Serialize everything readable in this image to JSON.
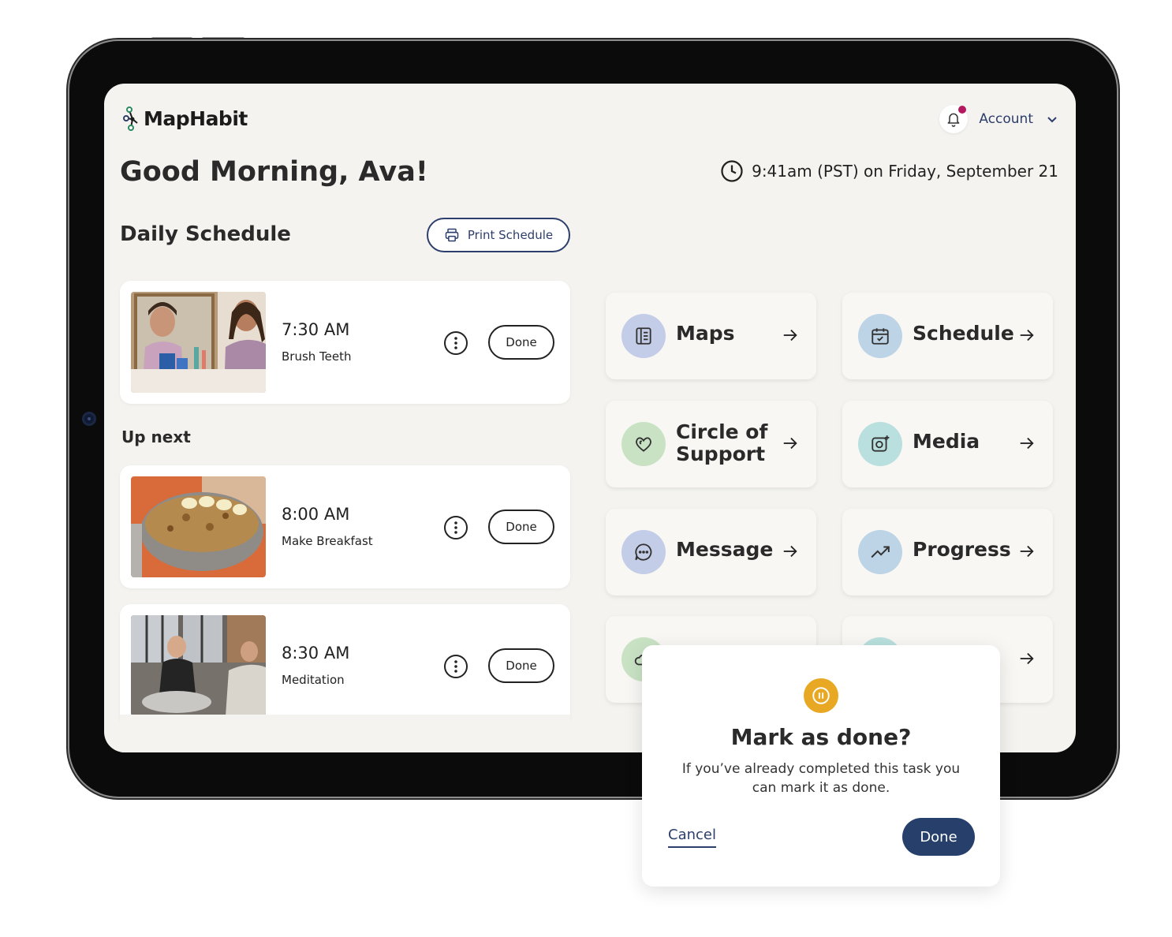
{
  "app": {
    "name": "MapHabit"
  },
  "header": {
    "account_label": "Account",
    "greeting": "Good Morning, Ava!",
    "datetime": "9:41am (PST) on Friday, September 21"
  },
  "schedule": {
    "title": "Daily Schedule",
    "print_label": "Print Schedule",
    "up_next_label": "Up next",
    "done_label": "Done",
    "tasks": [
      {
        "time": "7:30 AM",
        "name": "Brush Teeth"
      },
      {
        "time": "8:00 AM",
        "name": "Make Breakfast"
      },
      {
        "time": "8:30 AM",
        "name": "Meditation"
      }
    ]
  },
  "tiles": [
    {
      "label": "Maps",
      "icon": "book-icon",
      "color": "#c4cde8"
    },
    {
      "label": "Schedule",
      "icon": "calendar-check-icon",
      "color": "#bcd4e6"
    },
    {
      "label": "Circle of Support",
      "icon": "hearts-icon",
      "color": "#c9e2c4"
    },
    {
      "label": "Media",
      "icon": "camera-plus-icon",
      "color": "#b9e0de"
    },
    {
      "label": "Message",
      "icon": "chat-icon",
      "color": "#c4cde8"
    },
    {
      "label": "Progress",
      "icon": "trend-up-icon",
      "color": "#bcd4e6"
    }
  ],
  "dialog": {
    "title": "Mark as done?",
    "text": "If you’ve already completed this task you can mark it as done.",
    "cancel_label": "Cancel",
    "done_label": "Done",
    "icon": "pause-icon",
    "icon_color": "#e8a823"
  },
  "colors": {
    "brand_navy": "#263f6b",
    "notification_dot": "#b4185f",
    "screen_bg": "#f4f3ef"
  }
}
